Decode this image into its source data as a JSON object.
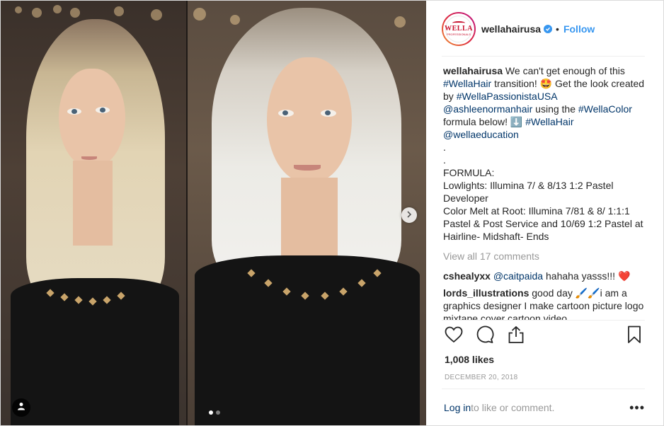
{
  "post": {
    "username": "wellahairusa",
    "follow_label": "Follow",
    "bullet": "•",
    "avatar_logo_text": "WELLA",
    "avatar_logo_sub": "PROFESSIONALS",
    "caption": {
      "username": "wellahairusa",
      "seg1": " We can't get enough of this ",
      "tag1": "#WellaHair",
      "seg2": " transition! 🤩 Get the look created by ",
      "tag2": "#WellaPassionistaUSA",
      "seg3": " ",
      "mention1": "@ashleenormanhair",
      "seg4": " using the ",
      "tag3": "#WellaColor",
      "seg5": " formula below! ⬇️ ",
      "tag4": "#WellaHair",
      "seg6": " ",
      "mention2": "@wellaeducation",
      "body": "\n.\n.\nFORMULA:\nLowlights: Illumina 7/ & 8/13 1:2 Pastel Developer\nColor Melt at Root:  Illumina 7/81 & 8/ 1:1:1 Pastel & Post Service and 10/69  1:2 Pastel at Hairline- Midshaft- Ends"
    },
    "view_all_comments": "View all 17 comments",
    "comments": [
      {
        "username": "cshealyxx",
        "mention": "@caitpaida",
        "text": " hahaha yasss!!! ❤️"
      },
      {
        "username": "lords_illustrations",
        "mention": "",
        "text": " good day 🖌️🖌️i am a graphics designer I make cartoon picture logo mixtape cover cartoon video"
      }
    ],
    "likes": "1,008 likes",
    "date": "DECEMBER 20, 2018",
    "footer": {
      "login_label": "Log in",
      "login_suffix": " to like or comment.",
      "more_label": "•••"
    }
  },
  "icons": {
    "like": "heart-icon",
    "comment": "comment-bubble-icon",
    "share": "share-icon",
    "save": "bookmark-icon",
    "next": "chevron-right-icon",
    "tags": "user-tag-icon",
    "verified": "verified-badge-icon"
  },
  "colors": {
    "link": "#003569",
    "accent": "#3897f0",
    "muted": "#999999",
    "brand": "#c8102e"
  },
  "carousel": {
    "count": 2,
    "active_index": 0
  }
}
